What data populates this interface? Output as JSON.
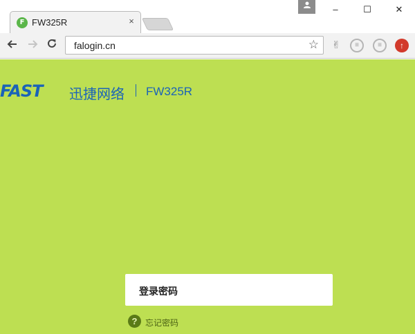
{
  "browser": {
    "tab": {
      "title": "FW325R",
      "favicon_letter": "F",
      "close": "×"
    },
    "window_controls": {
      "minimize": "–",
      "maximize": "☐",
      "close": "✕"
    },
    "address": "falogin.cn",
    "icons": {
      "back": "arrow-left-icon",
      "forward": "arrow-right-icon",
      "reload": "reload-icon",
      "star": "star-icon",
      "profile": "user-icon"
    }
  },
  "page": {
    "background": "#bddf52",
    "brand": {
      "logo": "FAST",
      "cn_name": "迅捷网络",
      "model": "FW325R"
    },
    "login_label": "登录密码",
    "forgot_icon": "?",
    "forgot_text": "忘记密码"
  }
}
